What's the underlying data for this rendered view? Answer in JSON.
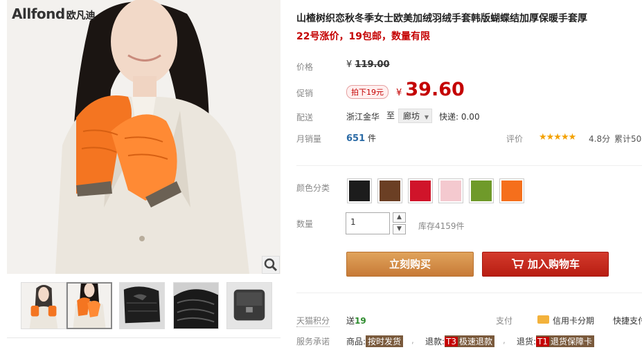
{
  "brand": {
    "logo_text_en": "Allfond",
    "logo_text_cn": "欧凡迪"
  },
  "gallery": {
    "thumbnails": [
      {
        "name": "orange-gloves-model",
        "color": "#ff7a2a",
        "bg": "#f3f1ee"
      },
      {
        "name": "orange-gloves-model-close",
        "color": "#ff7a2a",
        "bg": "#f3f1ee"
      },
      {
        "name": "black-gloves-bow",
        "color": "#222222",
        "bg": "#dcdcdc"
      },
      {
        "name": "black-gloves-detail",
        "color": "#1a1a1a",
        "bg": "#cfcfcf"
      },
      {
        "name": "black-gloves-knit-cuff",
        "color": "#3a3a3a",
        "bg": "#e5e5e5"
      }
    ],
    "selected_index": 1
  },
  "product": {
    "title": "山楂树织恋秋冬季女士欧美加绒羽绒手套韩版蝴蝶结加厚保暖手套厚",
    "subtitle": "22号涨价，19包邮，数量有限"
  },
  "price": {
    "label": "价格",
    "currency": "¥",
    "original": "119.00",
    "promo_label": "促销",
    "promo_tag": "拍下19元",
    "current": "39.60"
  },
  "shipping": {
    "label": "配送",
    "from": "浙江金华",
    "to_word": "至",
    "destination": "廊坊",
    "fee": "快递: 0.00"
  },
  "sales": {
    "label": "月销量",
    "count": "651",
    "unit": "件",
    "rating_label": "评价",
    "stars": "★★★★★",
    "score": "4.8分",
    "reviews": "累计50"
  },
  "colors": {
    "label": "颜色分类",
    "swatches": [
      {
        "name": "black",
        "color": "#1c1c1c"
      },
      {
        "name": "brown",
        "color": "#6b3f24"
      },
      {
        "name": "red",
        "color": "#d0142a"
      },
      {
        "name": "pink",
        "color": "#f4c9cf"
      },
      {
        "name": "green",
        "color": "#6f9a2a"
      },
      {
        "name": "orange",
        "color": "#f56f1c"
      }
    ]
  },
  "quantity": {
    "label": "数量",
    "value": "1",
    "stock": "库存4159件",
    "up": "▲",
    "down": "▼"
  },
  "actions": {
    "buy_now": "立刻购买",
    "add_to_cart": "加入购物车"
  },
  "services": {
    "points_label": "天猫积分",
    "points_prefix": "送",
    "points_value": "19",
    "pay_label": "支付",
    "pay_card": "信用卡分期",
    "pay_fast": "快捷支付",
    "promise_label": "服务承诺",
    "goods_label": "商品:",
    "goods_tag": "按时发货",
    "refund_label": "退款:",
    "refund_code": "T3",
    "refund_tag": "极速退款",
    "return_label": "退货:",
    "return_code": "T1",
    "return_tag": "退货保障卡"
  },
  "accent_colors": {
    "price_red": "#c40000",
    "buy": "#d08a45",
    "cart": "#c4271a"
  }
}
